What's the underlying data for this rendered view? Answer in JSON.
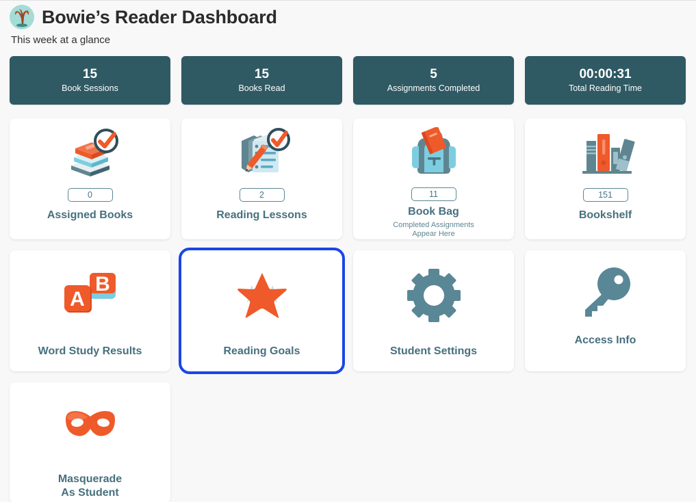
{
  "header": {
    "logo_icon": "tree-logo-icon",
    "title": "Bowie’s Reader Dashboard",
    "subtitle": "This week at a glance"
  },
  "colors": {
    "stat_card_bg": "#2f5963",
    "tile_label": "#47707f",
    "accent_orange": "#ef5a2a",
    "accent_teal": "#5b8694",
    "focus_blue": "#1a45e8",
    "page_bg": "#f8f8f9"
  },
  "stats": [
    {
      "value": "15",
      "label": "Book Sessions"
    },
    {
      "value": "15",
      "label": "Books Read"
    },
    {
      "value": "5",
      "label": "Assignments Completed"
    },
    {
      "value": "00:00:31",
      "label": "Total Reading Time"
    }
  ],
  "tiles": [
    {
      "id": "assigned-books",
      "icon": "books-stack-check-icon",
      "badge": "0",
      "label": "Assigned Books",
      "sublabel": "",
      "focused": false
    },
    {
      "id": "reading-lessons",
      "icon": "lesson-notepad-pencil-icon",
      "badge": "2",
      "label": "Reading Lessons",
      "sublabel": "",
      "focused": false
    },
    {
      "id": "book-bag",
      "icon": "backpack-icon",
      "badge": "11",
      "label": "Book Bag",
      "sublabel": "Completed Assignments Appear Here",
      "sublabel_line1": "Completed Assignments",
      "sublabel_line2": "Appear Here",
      "focused": false
    },
    {
      "id": "bookshelf",
      "icon": "bookshelf-icon",
      "badge": "151",
      "label": "Bookshelf",
      "sublabel": "",
      "focused": false
    },
    {
      "id": "word-study-results",
      "icon": "abc-blocks-icon",
      "badge": "",
      "label": "Word Study Results",
      "sublabel": "",
      "focused": false
    },
    {
      "id": "reading-goals",
      "icon": "star-icon",
      "badge": "",
      "label": "Reading Goals",
      "sublabel": "",
      "focused": true
    },
    {
      "id": "student-settings",
      "icon": "gear-icon",
      "badge": "",
      "label": "Student Settings",
      "sublabel": "",
      "focused": false
    },
    {
      "id": "access-info",
      "icon": "key-icon",
      "badge": "",
      "label": "Access Info",
      "sublabel": "",
      "focused": false
    },
    {
      "id": "masquerade-as-student",
      "icon": "mask-icon",
      "badge": "",
      "label": "Masquerade As Student",
      "label_line1": "Masquerade",
      "label_line2": "As Student",
      "sublabel": "",
      "focused": false
    }
  ]
}
